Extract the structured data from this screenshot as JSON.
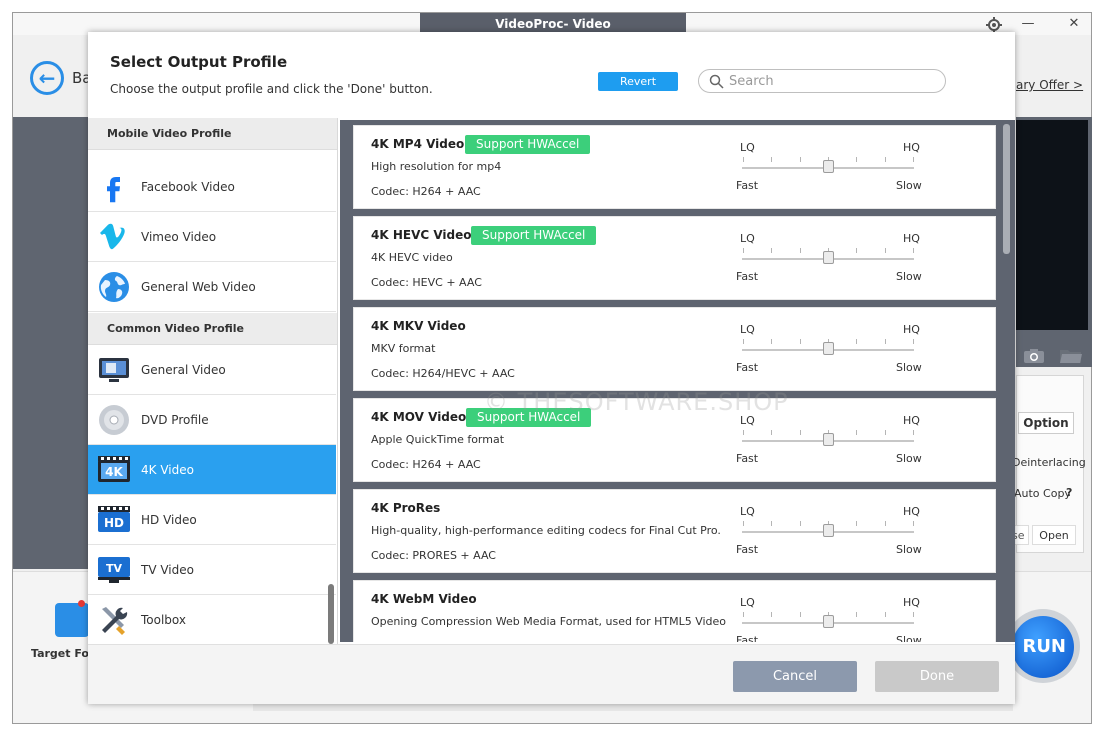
{
  "window": {
    "title": "VideoProc- Video",
    "minimize_label": "—",
    "close_label": "✕"
  },
  "background": {
    "back_label": "Ba",
    "offer_label": "ary Offer >",
    "option_label": "Option",
    "deinterlacing_label": "Deinterlacing",
    "autocopy_label": "Auto Copy",
    "help_mark": "?",
    "browse_label": "se",
    "open_label": "Open",
    "target_label": "Target Fo",
    "run_label": "RUN"
  },
  "modal": {
    "title": "Select Output Profile",
    "subtitle": "Choose the output profile and click the 'Done' button.",
    "revert_label": "Revert",
    "search": {
      "placeholder": "Search",
      "value": ""
    },
    "cancel_label": "Cancel",
    "done_label": "Done",
    "watermark": "© THESOFTWARE.SHOP"
  },
  "sidebar": {
    "categories": [
      {
        "label": "Mobile Video Profile"
      },
      {
        "label": "Common Video Profile"
      }
    ],
    "items": [
      {
        "label": "Facebook Video",
        "icon": "facebook-icon",
        "selected": false
      },
      {
        "label": "Vimeo Video",
        "icon": "vimeo-icon",
        "selected": false
      },
      {
        "label": "General Web Video",
        "icon": "globe-icon",
        "selected": false
      },
      {
        "label": "General Video",
        "icon": "monitor-icon",
        "selected": false
      },
      {
        "label": "DVD Profile",
        "icon": "dvd-icon",
        "selected": false
      },
      {
        "label": "4K Video",
        "icon": "4k-icon",
        "icon_text": "4K",
        "selected": true
      },
      {
        "label": "HD Video",
        "icon": "hd-icon",
        "icon_text": "HD",
        "selected": false
      },
      {
        "label": "TV Video",
        "icon": "tv-icon",
        "icon_text": "TV",
        "selected": false
      },
      {
        "label": "Toolbox",
        "icon": "toolbox-icon",
        "selected": false
      }
    ]
  },
  "quality_labels": {
    "lq": "LQ",
    "hq": "HQ",
    "fast": "Fast",
    "slow": "Slow"
  },
  "profiles": [
    {
      "name": "4K MP4 Video",
      "badge": "Support HWAccel",
      "description": "High resolution for mp4",
      "codec": "Codec: H264 + AAC",
      "quality": 0.5
    },
    {
      "name": "4K HEVC Video",
      "badge": "Support HWAccel",
      "description": "4K HEVC video",
      "codec": "Codec: HEVC + AAC",
      "quality": 0.5
    },
    {
      "name": "4K MKV Video",
      "badge": "",
      "description": "MKV format",
      "codec": "Codec: H264/HEVC + AAC",
      "quality": 0.5
    },
    {
      "name": "4K MOV Video",
      "badge": "Support HWAccel",
      "description": "Apple QuickTime format",
      "codec": "Codec: H264 + AAC",
      "quality": 0.5
    },
    {
      "name": "4K ProRes",
      "badge": "",
      "description": "High-quality, high-performance editing codecs for Final Cut Pro.",
      "codec": "Codec: PRORES + AAC",
      "quality": 0.5
    },
    {
      "name": "4K WebM Video",
      "badge": "",
      "description": "Opening Compression Web Media Format, used for HTML5 Video",
      "codec": "",
      "quality": 0.5
    }
  ],
  "colors": {
    "accent": "#2aa0ef",
    "badge": "#3ccf7b",
    "revert": "#1e9df0",
    "list_background": "#5e6470"
  }
}
